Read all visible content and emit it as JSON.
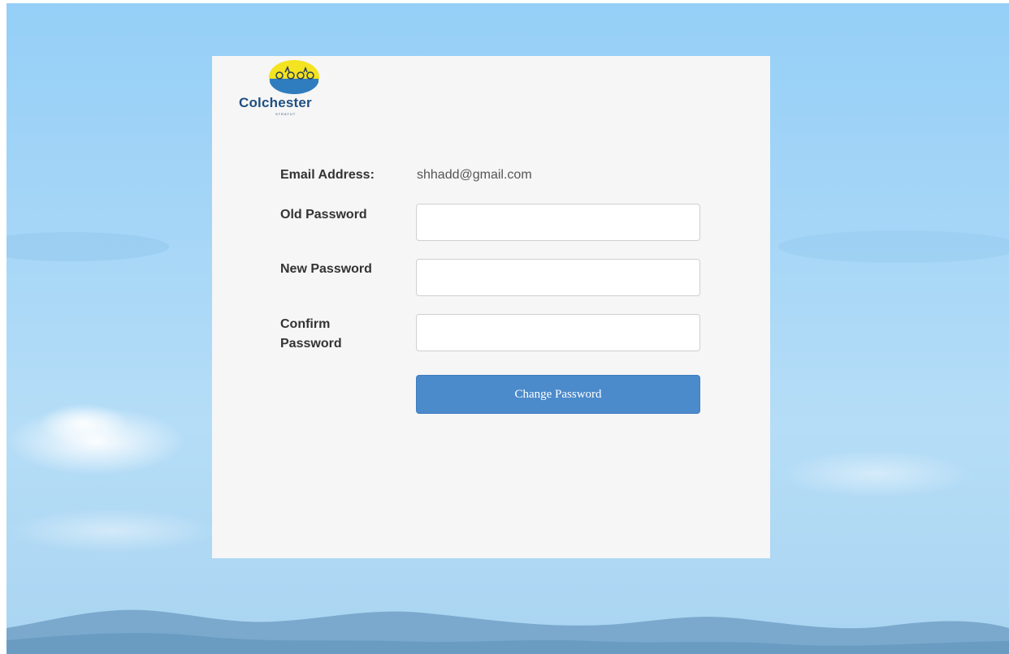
{
  "logo": {
    "name": "Colchester",
    "subtitle": "STRATUT"
  },
  "form": {
    "email_label": "Email Address:",
    "email_value": "shhadd@gmail.com",
    "old_password_label": "Old Password",
    "old_password_value": "",
    "new_password_label": "New Password",
    "new_password_value": "",
    "confirm_password_label_line1": "Confirm",
    "confirm_password_label_line2": "Password",
    "confirm_password_value": "",
    "submit_label": "Change Password"
  },
  "colors": {
    "button": "#4b8acb",
    "panel": "#f6f6f6",
    "sky": "#a6d6f7",
    "logo_text": "#1f4f80"
  },
  "icons": {
    "logo": "colchester-logo-icon"
  }
}
